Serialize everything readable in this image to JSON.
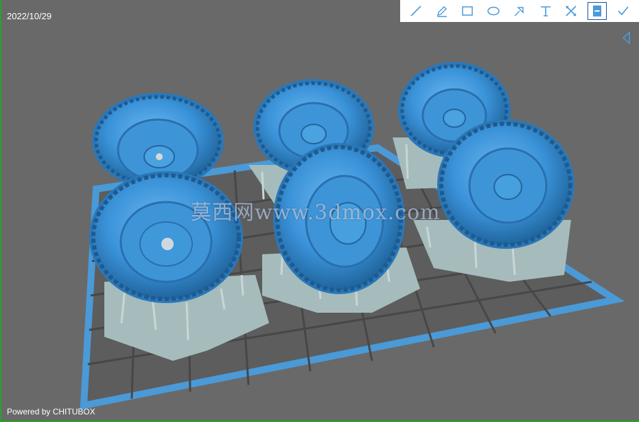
{
  "viewport": {
    "date": "2022/10/29",
    "powered_by": "Powered by CHITUBOX",
    "watermark": "莫西网www.3dmox.com"
  },
  "toolbar": {
    "tools": [
      {
        "name": "line-tool",
        "icon": "line-icon"
      },
      {
        "name": "pencil-tool",
        "icon": "pencil-icon"
      },
      {
        "name": "rectangle-tool",
        "icon": "rectangle-icon"
      },
      {
        "name": "ellipse-tool",
        "icon": "ellipse-icon"
      },
      {
        "name": "arrow-tool",
        "icon": "arrow-icon"
      },
      {
        "name": "text-tool",
        "icon": "text-icon"
      },
      {
        "name": "close-tool",
        "icon": "close-icon"
      },
      {
        "name": "save-tool",
        "icon": "save-icon"
      },
      {
        "name": "confirm-tool",
        "icon": "check-icon"
      }
    ],
    "active_tool": "save-tool"
  },
  "colors": {
    "background": "#696969",
    "plate_border": "#4a9ad8",
    "grid": "#5a5a5a",
    "tire": "#3a92d8",
    "support": "#a8c0c0",
    "toolbar_icon": "#4a9ad8",
    "active_border": "#1a4fa3"
  }
}
